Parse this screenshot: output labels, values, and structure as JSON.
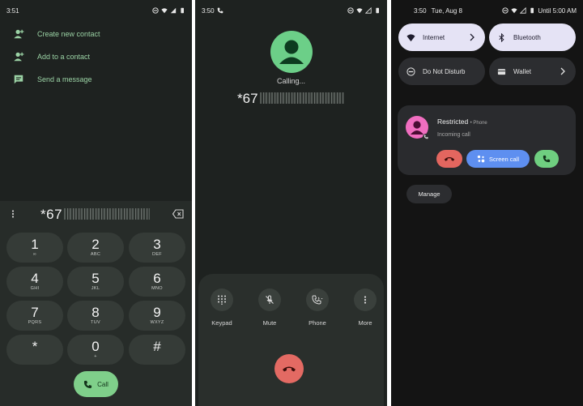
{
  "screen1": {
    "status_time": "3:51",
    "menu": [
      {
        "label": "Create new contact",
        "icon": "add-person-icon"
      },
      {
        "label": "Add to a contact",
        "icon": "add-person-icon"
      },
      {
        "label": "Send a message",
        "icon": "message-icon"
      }
    ],
    "dialed_visible": "*67",
    "keys": [
      {
        "digit": "1",
        "letters": "∞"
      },
      {
        "digit": "2",
        "letters": "ABC"
      },
      {
        "digit": "3",
        "letters": "DEF"
      },
      {
        "digit": "4",
        "letters": "GHI"
      },
      {
        "digit": "5",
        "letters": "JKL"
      },
      {
        "digit": "6",
        "letters": "MNO"
      },
      {
        "digit": "7",
        "letters": "PQRS"
      },
      {
        "digit": "8",
        "letters": "TUV"
      },
      {
        "digit": "9",
        "letters": "WXYZ"
      },
      {
        "digit": "*",
        "letters": ""
      },
      {
        "digit": "0",
        "letters": "+"
      },
      {
        "digit": "#",
        "letters": ""
      }
    ],
    "call_label": "Call",
    "accent": "#7fcf8a"
  },
  "screen2": {
    "status_time": "3:50",
    "calling_label": "Calling...",
    "dialed_visible": "*67",
    "controls": [
      {
        "label": "Keypad",
        "icon": "keypad-icon"
      },
      {
        "label": "Mute",
        "icon": "mic-off-icon"
      },
      {
        "label": "Phone",
        "icon": "phone-audio-icon"
      },
      {
        "label": "More",
        "icon": "more-vert-icon"
      }
    ],
    "hangup_color": "#e36a63"
  },
  "screen3": {
    "status_time": "3:50",
    "status_date": "Tue, Aug 8",
    "status_right": "Until 5:00 AM",
    "tiles": [
      {
        "label": "Internet",
        "icon": "wifi-icon",
        "active": true
      },
      {
        "label": "Bluetooth",
        "icon": "bluetooth-icon",
        "active": true
      },
      {
        "label": "Do Not Disturb",
        "icon": "dnd-icon",
        "active": false
      },
      {
        "label": "Wallet",
        "icon": "wallet-icon",
        "active": false
      }
    ],
    "notification": {
      "title": "Restricted",
      "source": "• Phone",
      "subtitle": "Incoming call",
      "screen_call_label": "Screen call"
    },
    "manage_label": "Manage"
  }
}
